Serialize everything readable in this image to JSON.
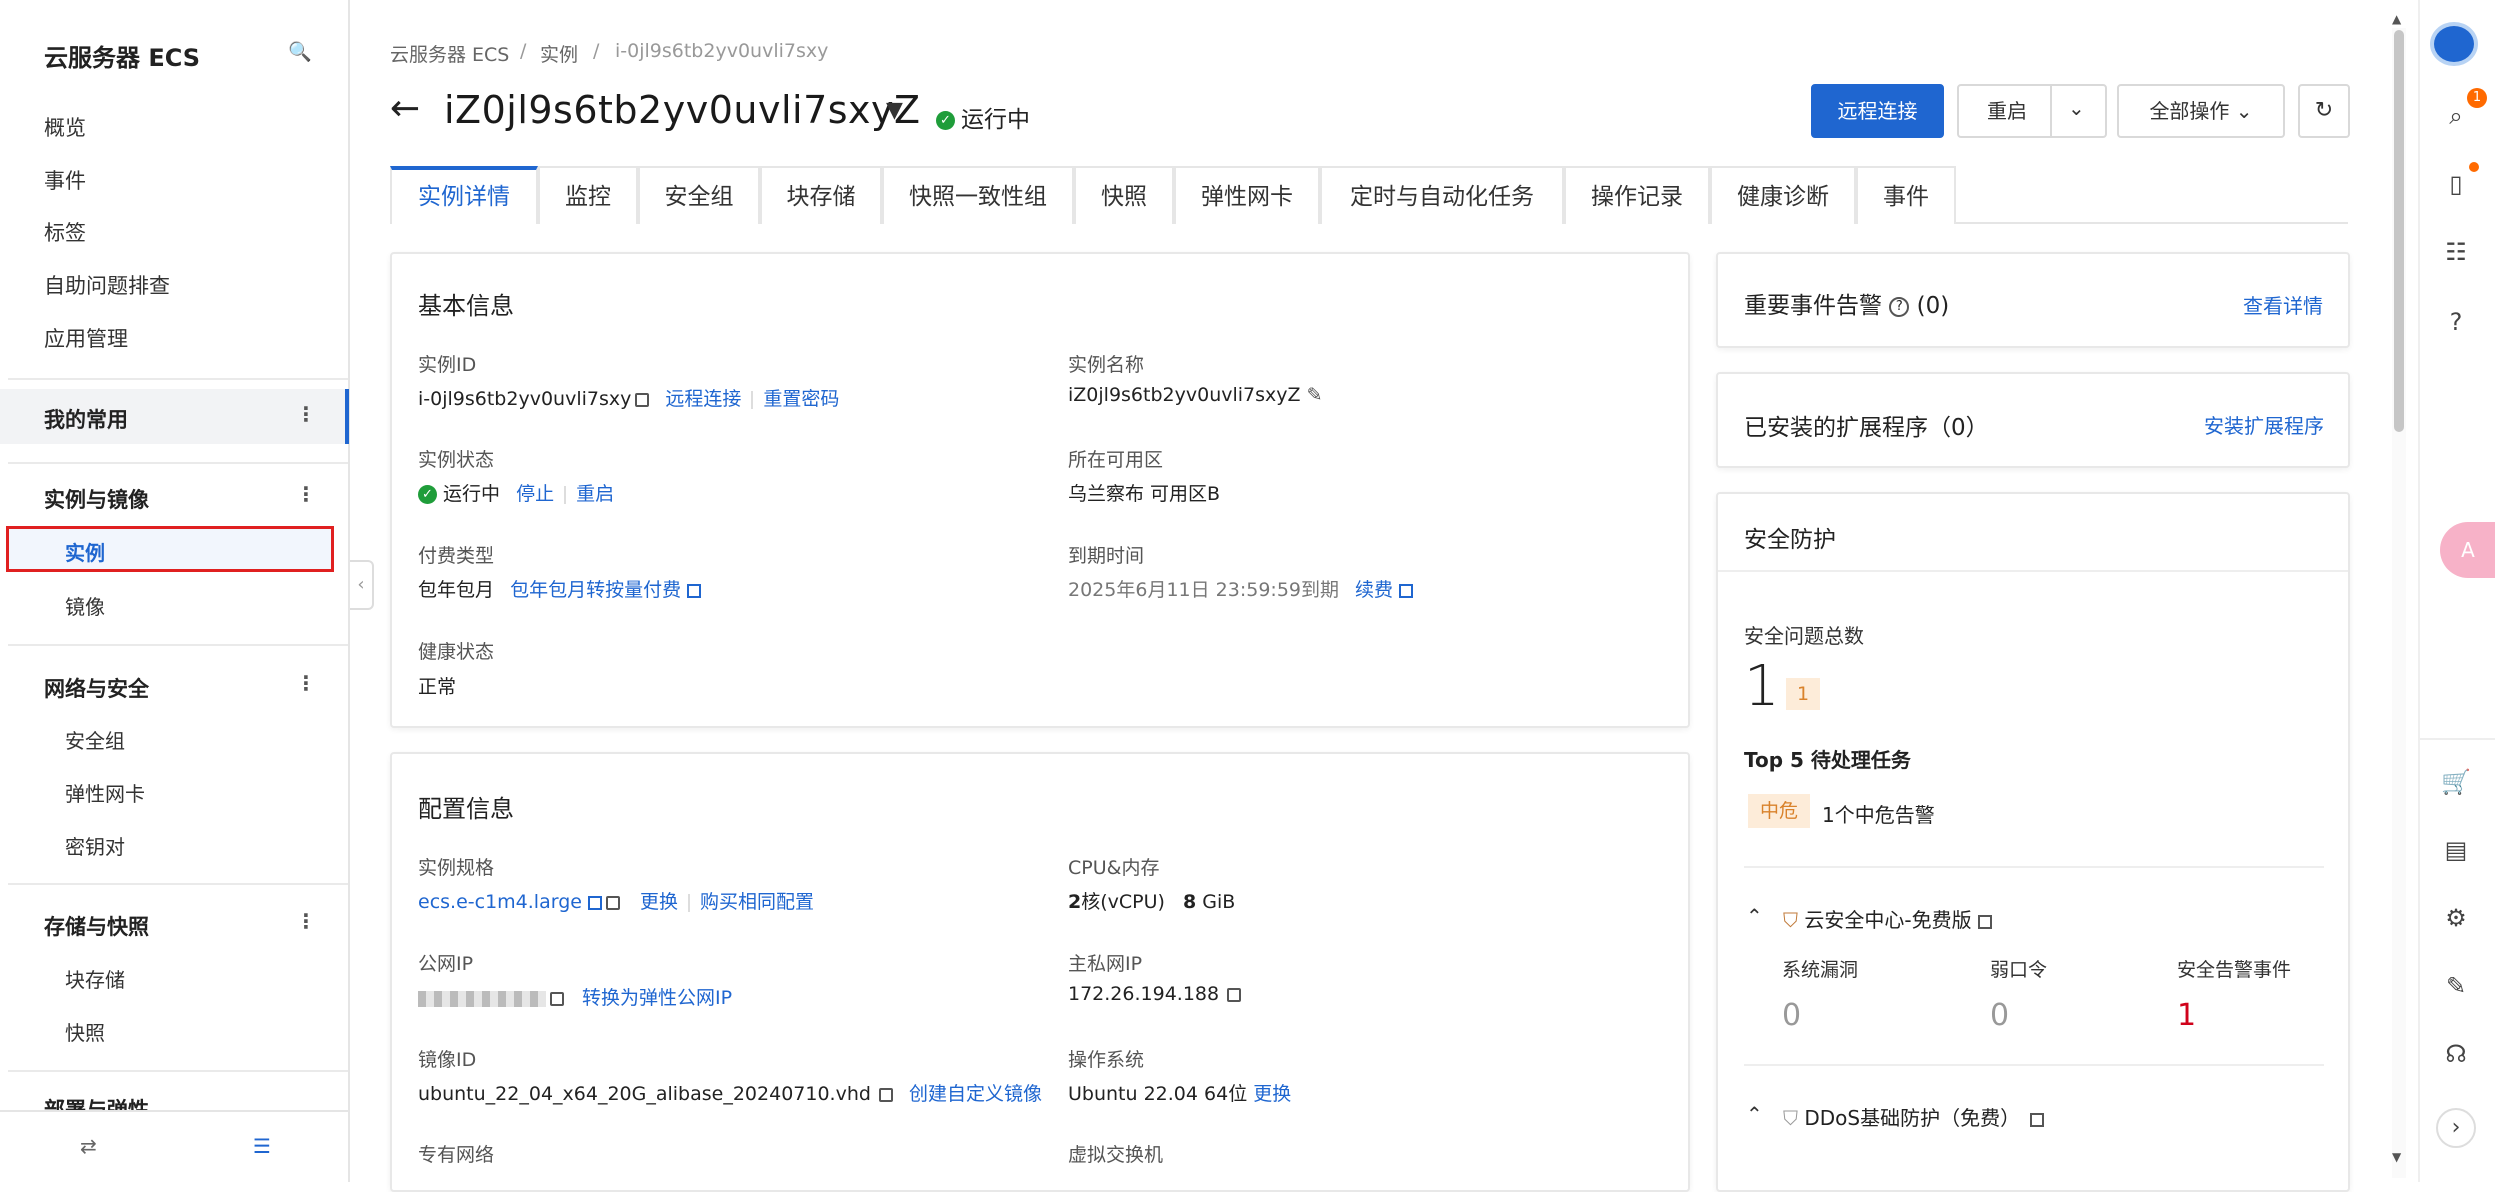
{
  "sidebar": {
    "title": "云服务器 ECS",
    "items": [
      "概览",
      "事件",
      "标签",
      "自助问题排查",
      "应用管理"
    ],
    "favorites": "我的常用",
    "groups": [
      {
        "title": "实例与镜像",
        "items": [
          "实例",
          "镜像"
        ]
      },
      {
        "title": "网络与安全",
        "items": [
          "安全组",
          "弹性网卡",
          "密钥对"
        ]
      },
      {
        "title": "存储与快照",
        "items": [
          "块存储",
          "快照"
        ]
      },
      {
        "title": "部署与弹性"
      }
    ]
  },
  "breadcrumb": {
    "root": "云服务器 ECS",
    "sep": "/",
    "mid": "实例",
    "leaf": "i-0jl9s6tb2yv0uvli7sxy"
  },
  "header": {
    "back": "←",
    "title": "iZ0jl9s6tb2yv0uvli7sxyZ",
    "status": "运行中",
    "btn_remote": "远程连接",
    "btn_restart": "重启",
    "btn_all": "全部操作"
  },
  "tabs": [
    "实例详情",
    "监控",
    "安全组",
    "块存储",
    "快照一致性组",
    "快照",
    "弹性网卡",
    "定时与自动化任务",
    "操作记录",
    "健康诊断",
    "事件"
  ],
  "basic": {
    "title": "基本信息",
    "id_label": "实例ID",
    "id": "i-0jl9s6tb2yv0uvli7sxy",
    "remote": "远程连接",
    "reset_pwd": "重置密码",
    "name_label": "实例名称",
    "name": "iZ0jl9s6tb2yv0uvli7sxyZ",
    "state_label": "实例状态",
    "state": "运行中",
    "stop": "停止",
    "restart": "重启",
    "zone_label": "所在可用区",
    "zone": "乌兰察布 可用区B",
    "pay_label": "付费类型",
    "pay": "包年包月",
    "pay_switch": "包年包月转按量付费",
    "expire_label": "到期时间",
    "expire": "2025年6月11日 23:59:59到期",
    "renew": "续费",
    "health_label": "健康状态",
    "health": "正常"
  },
  "config": {
    "title": "配置信息",
    "spec_label": "实例规格",
    "spec": "ecs.e-c1m4.large",
    "change": "更换",
    "buy_same": "购买相同配置",
    "cpu_label": "CPU&内存",
    "cpu": "2",
    "cpu_unit": "核(vCPU)",
    "mem": "8",
    "mem_unit": "GiB",
    "pubip_label": "公网IP",
    "to_eip": "转换为弹性公网IP",
    "privip_label": "主私网IP",
    "privip": "172.26.194.188",
    "image_label": "镜像ID",
    "image": "ubuntu_22_04_x64_20G_alibase_20240710.vhd",
    "create_image": "创建自定义镜像",
    "os_label": "操作系统",
    "os": "Ubuntu 22.04 64位",
    "os_change": "更换",
    "vpc_label": "专有网络",
    "vsw_label": "虚拟交换机"
  },
  "events": {
    "title": "重要事件告警",
    "count": "(0)",
    "link": "查看详情"
  },
  "extensions": {
    "title": "已安装的扩展程序（0）",
    "link": "安装扩展程序"
  },
  "security": {
    "title": "安全防护",
    "total_label": "安全问题总数",
    "total": "1",
    "badge": "1",
    "top5": "Top 5 待处理任务",
    "level": "中危",
    "alert": "1个中危告警",
    "center": "云安全中心-免费版",
    "cols": [
      "系统漏洞",
      "弱口令",
      "安全告警事件"
    ],
    "vals": [
      "0",
      "0",
      "1"
    ],
    "ddos": "DDoS基础防护（免费）"
  },
  "rail": {
    "badge": "1"
  }
}
